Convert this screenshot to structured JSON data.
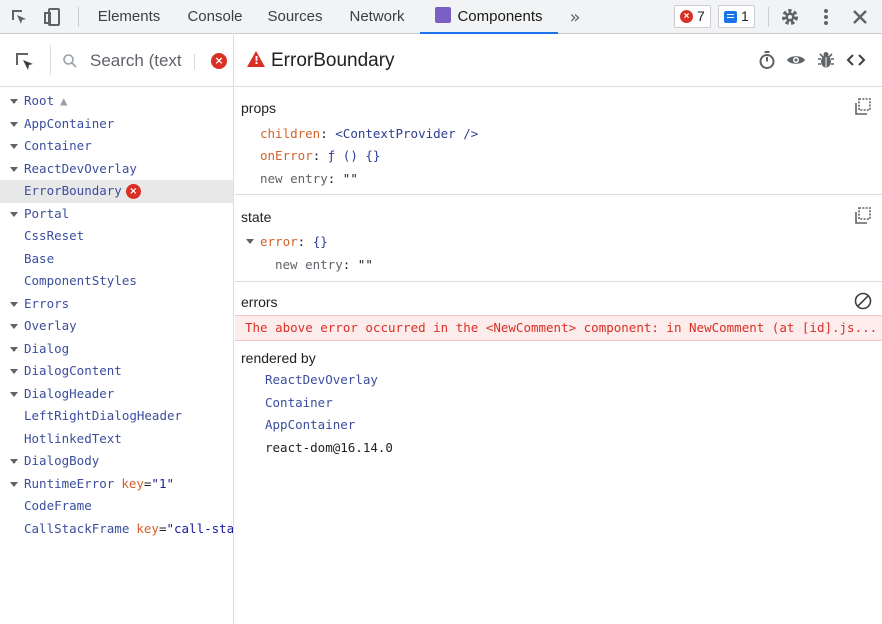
{
  "topbar": {
    "tabs": [
      "Elements",
      "Console",
      "Sources",
      "Network",
      "Components"
    ],
    "active_tab": "Components",
    "error_count": "7",
    "message_count": "1"
  },
  "left": {
    "search_placeholder": "Search (text",
    "tree": [
      {
        "name": "Root",
        "expanded": true,
        "warning": true
      },
      {
        "name": "AppContainer",
        "expanded": true
      },
      {
        "name": "Container",
        "expanded": true
      },
      {
        "name": "ReactDevOverlay",
        "expanded": true
      },
      {
        "name": "ErrorBoundary",
        "selected": true,
        "error": true
      },
      {
        "name": "Portal",
        "expanded": true
      },
      {
        "name": "CssReset"
      },
      {
        "name": "Base"
      },
      {
        "name": "ComponentStyles"
      },
      {
        "name": "Errors",
        "expanded": true
      },
      {
        "name": "Overlay",
        "expanded": true
      },
      {
        "name": "Dialog",
        "expanded": true
      },
      {
        "name": "DialogContent",
        "expanded": true
      },
      {
        "name": "DialogHeader",
        "expanded": true
      },
      {
        "name": "LeftRightDialogHeader"
      },
      {
        "name": "HotlinkedText"
      },
      {
        "name": "DialogBody",
        "expanded": true
      },
      {
        "name": "RuntimeError",
        "expanded": true,
        "key": "key",
        "key_value": "\"1\""
      },
      {
        "name": "CodeFrame"
      },
      {
        "name": "CallStackFrame",
        "key": "key",
        "key_value": "\"call-sta"
      }
    ]
  },
  "right": {
    "component_name": "ErrorBoundary",
    "props": {
      "title": "props",
      "entries": [
        {
          "key": "children",
          "value": "<ContextProvider />"
        },
        {
          "key": "onError",
          "value": "ƒ () {}"
        },
        {
          "key": "new entry",
          "value": "\"\""
        }
      ]
    },
    "state": {
      "title": "state",
      "error_key": "error",
      "error_value": "{}",
      "new_entry_key": "new entry",
      "new_entry_value": "\"\""
    },
    "errors": {
      "title": "errors",
      "message": "The above error occurred in the <NewComment> component: in NewComment (at [id].js..."
    },
    "rendered_by": {
      "title": "rendered by",
      "owners": [
        "ReactDevOverlay",
        "Container",
        "AppContainer"
      ],
      "renderer": "react-dom@16.14.0"
    }
  }
}
